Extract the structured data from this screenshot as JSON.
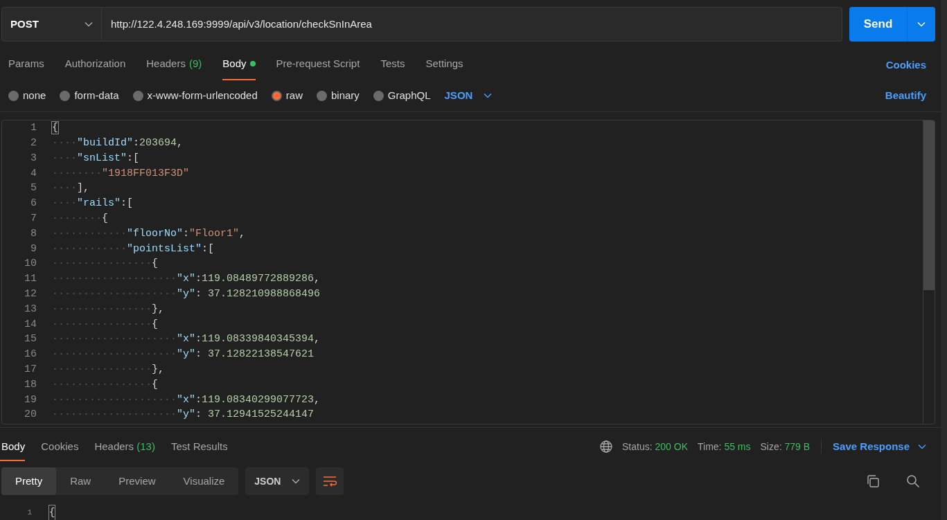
{
  "request": {
    "method": "POST",
    "url": "http://122.4.248.169:9999/api/v3/location/checkSnInArea",
    "send": "Send"
  },
  "request_tabs": [
    {
      "label": "Params",
      "selected": false
    },
    {
      "label": "Authorization",
      "selected": false
    },
    {
      "label": "Headers",
      "count": "(9)",
      "selected": false
    },
    {
      "label": "Body",
      "selected": true,
      "dot": true
    },
    {
      "label": "Pre-request Script",
      "selected": false
    },
    {
      "label": "Tests",
      "selected": false
    },
    {
      "label": "Settings",
      "selected": false
    }
  ],
  "cookies_link": "Cookies",
  "body_types": [
    {
      "label": "none",
      "selected": false
    },
    {
      "label": "form-data",
      "selected": false
    },
    {
      "label": "x-www-form-urlencoded",
      "selected": false
    },
    {
      "label": "raw",
      "selected": true
    },
    {
      "label": "binary",
      "selected": false
    },
    {
      "label": "GraphQL",
      "selected": false
    }
  ],
  "raw_format": "JSON",
  "beautify": "Beautify",
  "editor_lines": [
    {
      "number": "1",
      "tokens": [
        {
          "kind": "brace",
          "text": "{"
        }
      ]
    },
    {
      "number": "2",
      "tokens": [
        {
          "kind": "indent",
          "text": "····"
        },
        {
          "kind": "key",
          "text": "\"buildId\""
        },
        {
          "kind": "punct",
          "text": ":"
        },
        {
          "kind": "num",
          "text": "203694"
        },
        {
          "kind": "punct",
          "text": ","
        }
      ]
    },
    {
      "number": "3",
      "tokens": [
        {
          "kind": "indent",
          "text": "····"
        },
        {
          "kind": "key",
          "text": "\"snList\""
        },
        {
          "kind": "punct",
          "text": ":["
        }
      ]
    },
    {
      "number": "4",
      "tokens": [
        {
          "kind": "indent",
          "text": "········"
        },
        {
          "kind": "str",
          "text": "\"1918FF013F3D\""
        }
      ]
    },
    {
      "number": "5",
      "tokens": [
        {
          "kind": "indent",
          "text": "····"
        },
        {
          "kind": "punct",
          "text": "],"
        }
      ]
    },
    {
      "number": "6",
      "tokens": [
        {
          "kind": "indent",
          "text": "····"
        },
        {
          "kind": "key",
          "text": "\"rails\""
        },
        {
          "kind": "punct",
          "text": ":["
        }
      ]
    },
    {
      "number": "7",
      "tokens": [
        {
          "kind": "indent",
          "text": "········"
        },
        {
          "kind": "punct",
          "text": "{"
        }
      ]
    },
    {
      "number": "8",
      "tokens": [
        {
          "kind": "indent",
          "text": "············"
        },
        {
          "kind": "key",
          "text": "\"floorNo\""
        },
        {
          "kind": "punct",
          "text": ":"
        },
        {
          "kind": "str",
          "text": "\"Floor1\""
        },
        {
          "kind": "punct",
          "text": ","
        }
      ]
    },
    {
      "number": "9",
      "tokens": [
        {
          "kind": "indent",
          "text": "············"
        },
        {
          "kind": "key",
          "text": "\"pointsList\""
        },
        {
          "kind": "punct",
          "text": ":["
        }
      ]
    },
    {
      "number": "10",
      "tokens": [
        {
          "kind": "indent",
          "text": "················"
        },
        {
          "kind": "punct",
          "text": "{"
        }
      ]
    },
    {
      "number": "11",
      "tokens": [
        {
          "kind": "indent",
          "text": "····················"
        },
        {
          "kind": "key",
          "text": "\"x\""
        },
        {
          "kind": "punct",
          "text": ":"
        },
        {
          "kind": "num",
          "text": "119.08489772889286"
        },
        {
          "kind": "punct",
          "text": ","
        }
      ]
    },
    {
      "number": "12",
      "tokens": [
        {
          "kind": "indent",
          "text": "····················"
        },
        {
          "kind": "key",
          "text": "\"y\""
        },
        {
          "kind": "punct",
          "text": ": "
        },
        {
          "kind": "num",
          "text": "37.128210988868496"
        }
      ]
    },
    {
      "number": "13",
      "tokens": [
        {
          "kind": "indent",
          "text": "················"
        },
        {
          "kind": "punct",
          "text": "},"
        }
      ]
    },
    {
      "number": "14",
      "tokens": [
        {
          "kind": "indent",
          "text": "················"
        },
        {
          "kind": "punct",
          "text": "{"
        }
      ]
    },
    {
      "number": "15",
      "tokens": [
        {
          "kind": "indent",
          "text": "····················"
        },
        {
          "kind": "key",
          "text": "\"x\""
        },
        {
          "kind": "punct",
          "text": ":"
        },
        {
          "kind": "num",
          "text": "119.08339840345394"
        },
        {
          "kind": "punct",
          "text": ","
        }
      ]
    },
    {
      "number": "16",
      "tokens": [
        {
          "kind": "indent",
          "text": "····················"
        },
        {
          "kind": "key",
          "text": "\"y\""
        },
        {
          "kind": "punct",
          "text": ": "
        },
        {
          "kind": "num",
          "text": "37.12822138547621"
        }
      ]
    },
    {
      "number": "17",
      "tokens": [
        {
          "kind": "indent",
          "text": "················"
        },
        {
          "kind": "punct",
          "text": "},"
        }
      ]
    },
    {
      "number": "18",
      "tokens": [
        {
          "kind": "indent",
          "text": "················"
        },
        {
          "kind": "punct",
          "text": "{"
        }
      ]
    },
    {
      "number": "19",
      "tokens": [
        {
          "kind": "indent",
          "text": "····················"
        },
        {
          "kind": "key",
          "text": "\"x\""
        },
        {
          "kind": "punct",
          "text": ":"
        },
        {
          "kind": "num",
          "text": "119.08340299077723"
        },
        {
          "kind": "punct",
          "text": ","
        }
      ]
    },
    {
      "number": "20",
      "tokens": [
        {
          "kind": "indent",
          "text": "····················"
        },
        {
          "kind": "key",
          "text": "\"y\""
        },
        {
          "kind": "punct",
          "text": ": "
        },
        {
          "kind": "num",
          "text": "37.12941525244147"
        }
      ]
    }
  ],
  "response_tabs": [
    {
      "label": "Body",
      "selected": true
    },
    {
      "label": "Cookies",
      "selected": false
    },
    {
      "label": "Headers",
      "count": "(13)",
      "selected": false
    },
    {
      "label": "Test Results",
      "selected": false
    }
  ],
  "status": [
    {
      "label": "Status:",
      "value": "200 OK"
    },
    {
      "label": "Time:",
      "value": "55 ms"
    },
    {
      "label": "Size:",
      "value": "779 B"
    }
  ],
  "save_response": "Save Response",
  "view_modes": [
    {
      "label": "Pretty",
      "selected": true
    },
    {
      "label": "Raw",
      "selected": false
    },
    {
      "label": "Preview",
      "selected": false
    },
    {
      "label": "Visualize",
      "selected": false
    }
  ],
  "response_format": "JSON",
  "response_lines": [
    {
      "number": "1",
      "text": "{"
    }
  ]
}
